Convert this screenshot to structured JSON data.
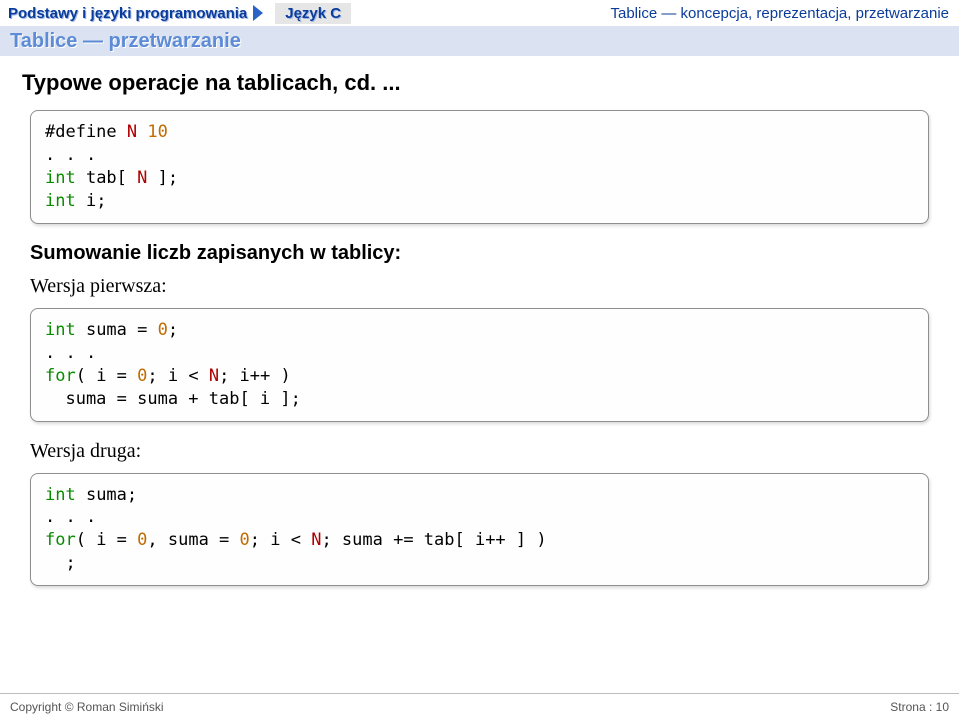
{
  "header": {
    "breadcrumb": "Podstawy i języki programowania",
    "lang": "Język C",
    "right": "Tablice — koncepcja, reprezentacja, przetwarzanie"
  },
  "subtitle": "Tablice — przetwarzanie",
  "section_title": "Typowe operacje na tablicach, cd. ...",
  "code_defs": {
    "l1_pre": "#define ",
    "l1_id": "N",
    "l1_sp": " ",
    "l1_num": "10",
    "l2": ". . .",
    "l3_kw": "int",
    "l3_mid": " tab[ ",
    "l3_id": "N",
    "l3_end": " ];",
    "l4_kw": "int",
    "l4_end": " i;"
  },
  "subhead1": "Sumowanie liczb zapisanych w tablicy:",
  "ver1": "Wersja pierwsza:",
  "code1": {
    "l1_kw": "int",
    "l1_mid": " suma = ",
    "l1_num": "0",
    "l1_end": ";",
    "l2": ". . .",
    "l3_kw": "for",
    "l3_a": "( i = ",
    "l3_n0": "0",
    "l3_b": "; i < ",
    "l3_id": "N",
    "l3_c": "; i++ )",
    "l4": "  suma = suma + tab[ i ];"
  },
  "ver2": "Wersja druga:",
  "code2": {
    "l1_kw": "int",
    "l1_end": " suma;",
    "l2": ". . .",
    "l3_kw": "for",
    "l3_a": "( i = ",
    "l3_n0a": "0",
    "l3_b": ", suma = ",
    "l3_n0b": "0",
    "l3_c": "; i < ",
    "l3_id": "N",
    "l3_d": "; suma += tab[ i++ ] )",
    "l4": "  ;"
  },
  "footer": {
    "left": "Copyright © Roman Simiński",
    "right": "Strona : 10"
  }
}
